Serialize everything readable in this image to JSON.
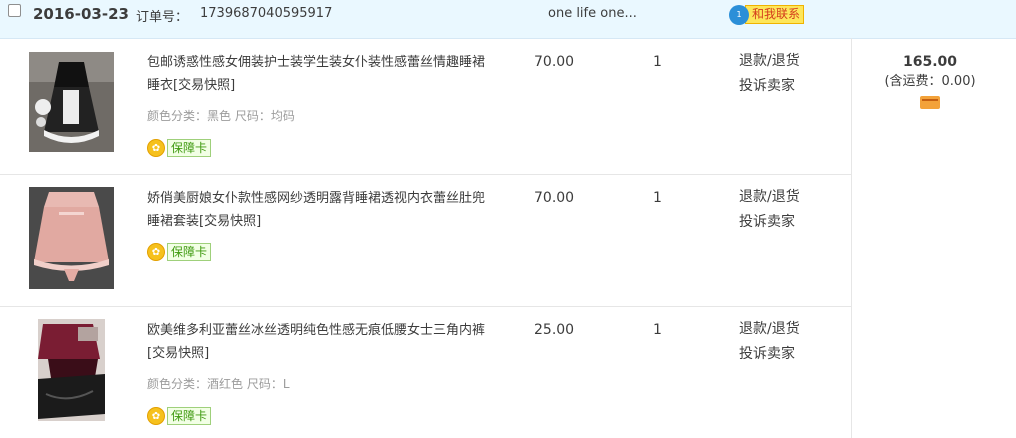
{
  "order": {
    "date": "2016-03-23",
    "order_label": "订单号：",
    "order_number": "1739687040595917",
    "shop_name": "one life one...",
    "contact_badge": "1",
    "contact_label": "和我联系"
  },
  "items": [
    {
      "title": "包邮诱惑性感女佣装护士装学生装女仆装性感蕾丝情趣睡裙睡衣[交易快照]",
      "sku": "颜色分类：黑色  尺码：均码",
      "badge": "保障卡",
      "price": "70.00",
      "qty": "1",
      "action_refund": "退款/退货",
      "action_complain": "投诉卖家"
    },
    {
      "title": "娇俏美厨娘女仆款性感网纱透明露背睡裙透视内衣蕾丝肚兜睡裙套装[交易快照]",
      "sku": "",
      "badge": "保障卡",
      "price": "70.00",
      "qty": "1",
      "action_refund": "退款/退货",
      "action_complain": "投诉卖家"
    },
    {
      "title": "欧美维多利亚蕾丝冰丝透明纯色性感无痕低腰女士三角内裤[交易快照]",
      "sku": "颜色分类：酒红色  尺码：L",
      "badge": "保障卡",
      "price": "25.00",
      "qty": "1",
      "action_refund": "退款/退货",
      "action_complain": "投诉卖家"
    }
  ],
  "total": {
    "amount": "165.00",
    "shipping": "(含运费：0.00)",
    "card_icon": "credit-card-icon"
  },
  "colors": {
    "header_bg": "#eaf8ff",
    "contact_bg": "#fde65a",
    "badge_green": "#3f9a10"
  }
}
